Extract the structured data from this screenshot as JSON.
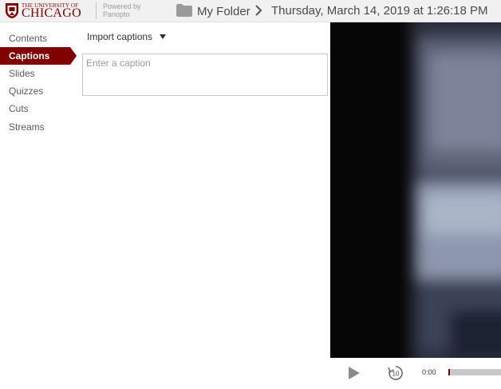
{
  "header": {
    "logo_top": "THE UNIVERSITY OF",
    "logo_main": "CHICAGO",
    "powered_line1": "Powered by",
    "powered_line2": "Panopto",
    "folder_label": "My Folder",
    "session_title": "Thursday, March 14, 2019 at 1:26:18 PM"
  },
  "sidebar": {
    "items": [
      {
        "label": "Contents",
        "active": false
      },
      {
        "label": "Captions",
        "active": true
      },
      {
        "label": "Slides",
        "active": false
      },
      {
        "label": "Quizzes",
        "active": false
      },
      {
        "label": "Cuts",
        "active": false
      },
      {
        "label": "Streams",
        "active": false
      }
    ]
  },
  "captions": {
    "import_label": "Import captions",
    "input_placeholder": "Enter a caption",
    "input_value": ""
  },
  "player": {
    "time": "0:00",
    "progress": 0.03,
    "rewind_seconds": "10"
  },
  "colors": {
    "accent": "#800000",
    "header_bg": "#f1f1f1",
    "scrub_track": "#c8c8c8"
  },
  "icons": [
    "university-shield-icon",
    "folder-icon",
    "chevron-right-icon",
    "caret-down-icon",
    "play-icon",
    "rewind-10-icon"
  ]
}
